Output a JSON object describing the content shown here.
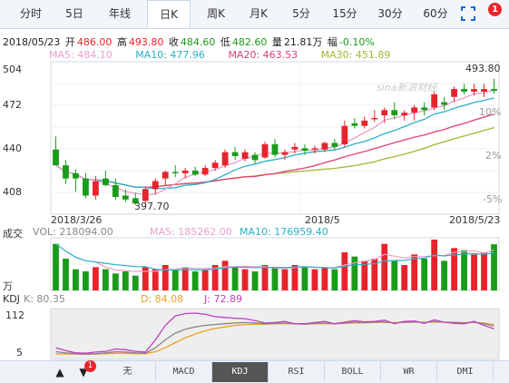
{
  "tabs": [
    "分时",
    "5日",
    "年线",
    "日K",
    "周K",
    "月K",
    "5分",
    "15分",
    "30分",
    "60分"
  ],
  "active_tab": "日K",
  "notification_count": "1",
  "ohlc": {
    "date": "2018/05/23",
    "open_label": "开",
    "open": "486.00",
    "high_label": "高",
    "high": "493.80",
    "close_label": "收",
    "close": "484.60",
    "low_label": "低",
    "low": "482.60",
    "vol_label": "量",
    "vol": "21.81万",
    "chg_label": "幅",
    "chg": "-0.10%"
  },
  "ma": {
    "ma5": "MA5: 484.10",
    "ma10": "MA10: 477.96",
    "ma20": "MA20: 463.53",
    "ma30": "MA30: 451.89",
    "ma5_color": "#e8a0c8",
    "ma10_color": "#2ab0c8",
    "ma20_color": "#e04070",
    "ma30_color": "#a0b830"
  },
  "price_axis": [
    "504",
    "472",
    "440",
    "408"
  ],
  "pct_axis": [
    "10%",
    "2%",
    "-5%"
  ],
  "max_label": "493.80",
  "min_label": "397.70",
  "watermark": "sina新浪财经",
  "dates": [
    "2018/3/26",
    "2018/5",
    "2018/5/23"
  ],
  "volume": {
    "title": "成交",
    "vol": "VOL: 218094.00",
    "ma5": "MA5: 185262.00",
    "ma10": "MA10: 176959.40",
    "unit": "万"
  },
  "kdj": {
    "title": "KDJ",
    "k": "K: 80.35",
    "d": "D: 84.08",
    "j": "J: 72.89",
    "axis_top": "112",
    "axis_bottom": "5",
    "k_color": "#888888",
    "d_color": "#f0a020",
    "j_color": "#c040c0"
  },
  "bottom_tabs": [
    "无",
    "MACD",
    "KDJ",
    "RSI",
    "BOLL",
    "WR",
    "DMI"
  ],
  "bottom_active": "KDJ",
  "bottom_badge": "1",
  "colors": {
    "up": "#e8232b",
    "down": "#1a9c1a",
    "accent": "#1a6ad0"
  },
  "chart_data": {
    "type": "candlestick",
    "price_range": [
      395,
      504
    ],
    "candles": [
      {
        "o": 440,
        "h": 450,
        "l": 428,
        "c": 428
      },
      {
        "o": 428,
        "h": 432,
        "l": 414,
        "c": 418
      },
      {
        "o": 422,
        "h": 425,
        "l": 408,
        "c": 418
      },
      {
        "o": 418,
        "h": 422,
        "l": 403,
        "c": 405
      },
      {
        "o": 405,
        "h": 420,
        "l": 402,
        "c": 416
      },
      {
        "o": 418,
        "h": 424,
        "l": 412,
        "c": 413
      },
      {
        "o": 413,
        "h": 418,
        "l": 402,
        "c": 404
      },
      {
        "o": 405,
        "h": 410,
        "l": 400,
        "c": 402
      },
      {
        "o": 403,
        "h": 407,
        "l": 398,
        "c": 399
      },
      {
        "o": 401,
        "h": 412,
        "l": 399,
        "c": 410
      },
      {
        "o": 410,
        "h": 418,
        "l": 406,
        "c": 416
      },
      {
        "o": 418,
        "h": 424,
        "l": 413,
        "c": 423
      },
      {
        "o": 423,
        "h": 428,
        "l": 419,
        "c": 422
      },
      {
        "o": 422,
        "h": 426,
        "l": 418,
        "c": 424
      },
      {
        "o": 424,
        "h": 427,
        "l": 420,
        "c": 421
      },
      {
        "o": 421,
        "h": 428,
        "l": 420,
        "c": 426
      },
      {
        "o": 426,
        "h": 432,
        "l": 424,
        "c": 430
      },
      {
        "o": 428,
        "h": 440,
        "l": 426,
        "c": 438
      },
      {
        "o": 438,
        "h": 442,
        "l": 432,
        "c": 435
      },
      {
        "o": 433,
        "h": 440,
        "l": 431,
        "c": 438
      },
      {
        "o": 436,
        "h": 438,
        "l": 429,
        "c": 432
      },
      {
        "o": 434,
        "h": 446,
        "l": 433,
        "c": 444
      },
      {
        "o": 444,
        "h": 448,
        "l": 434,
        "c": 436
      },
      {
        "o": 436,
        "h": 440,
        "l": 432,
        "c": 438
      },
      {
        "o": 440,
        "h": 445,
        "l": 437,
        "c": 442
      },
      {
        "o": 441,
        "h": 444,
        "l": 436,
        "c": 439
      },
      {
        "o": 440,
        "h": 443,
        "l": 437,
        "c": 441
      },
      {
        "o": 440,
        "h": 446,
        "l": 438,
        "c": 445
      },
      {
        "o": 445,
        "h": 448,
        "l": 440,
        "c": 442
      },
      {
        "o": 444,
        "h": 462,
        "l": 442,
        "c": 458
      },
      {
        "o": 460,
        "h": 464,
        "l": 456,
        "c": 458
      },
      {
        "o": 458,
        "h": 465,
        "l": 456,
        "c": 462
      },
      {
        "o": 463,
        "h": 470,
        "l": 461,
        "c": 464
      },
      {
        "o": 466,
        "h": 472,
        "l": 460,
        "c": 470
      },
      {
        "o": 470,
        "h": 476,
        "l": 463,
        "c": 466
      },
      {
        "o": 466,
        "h": 470,
        "l": 462,
        "c": 468
      },
      {
        "o": 468,
        "h": 474,
        "l": 462,
        "c": 472
      },
      {
        "o": 472,
        "h": 476,
        "l": 466,
        "c": 470
      },
      {
        "o": 472,
        "h": 484,
        "l": 470,
        "c": 482
      },
      {
        "o": 476,
        "h": 480,
        "l": 470,
        "c": 474
      },
      {
        "o": 480,
        "h": 488,
        "l": 476,
        "c": 486
      },
      {
        "o": 486,
        "h": 490,
        "l": 482,
        "c": 484
      },
      {
        "o": 484,
        "h": 490,
        "l": 481,
        "c": 486
      },
      {
        "o": 484,
        "h": 490,
        "l": 480,
        "c": 486
      },
      {
        "o": 486,
        "h": 493.8,
        "l": 482.6,
        "c": 484.6
      }
    ],
    "volumes": [
      22,
      15,
      10,
      9,
      11,
      10,
      8,
      9,
      7,
      11,
      10,
      12,
      10,
      11,
      9,
      10,
      12,
      14,
      11,
      10,
      9,
      12,
      11,
      10,
      12,
      11,
      10,
      11,
      10,
      18,
      16,
      14,
      15,
      22,
      14,
      12,
      17,
      15,
      24,
      14,
      20,
      19,
      17,
      18,
      21.8
    ],
    "vol_range": [
      0,
      24
    ],
    "kdj_range": [
      0,
      120
    ],
    "k": [
      15,
      12,
      10,
      9,
      10,
      12,
      15,
      14,
      12,
      11,
      25,
      45,
      62,
      72,
      78,
      82,
      84,
      86,
      88,
      89,
      88,
      86,
      87,
      88,
      86,
      85,
      87,
      88,
      86,
      88,
      90,
      89,
      90,
      91,
      88,
      90,
      91,
      89,
      92,
      90,
      89,
      88,
      90,
      86,
      80.35
    ],
    "d": [
      10,
      9,
      9,
      8,
      9,
      10,
      11,
      11,
      10,
      10,
      15,
      25,
      38,
      50,
      60,
      68,
      74,
      78,
      82,
      84,
      85,
      85,
      86,
      86,
      86,
      85,
      86,
      86,
      86,
      87,
      88,
      88,
      89,
      89,
      89,
      89,
      90,
      90,
      90,
      90,
      90,
      89,
      89,
      88,
      84.08
    ],
    "j": [
      25,
      18,
      12,
      11,
      14,
      16,
      22,
      20,
      16,
      14,
      45,
      82,
      106,
      112,
      113,
      110,
      104,
      102,
      100,
      99,
      94,
      88,
      89,
      92,
      86,
      86,
      89,
      92,
      86,
      90,
      94,
      91,
      92,
      95,
      86,
      92,
      93,
      87,
      96,
      90,
      87,
      86,
      92,
      82,
      72.89
    ]
  }
}
